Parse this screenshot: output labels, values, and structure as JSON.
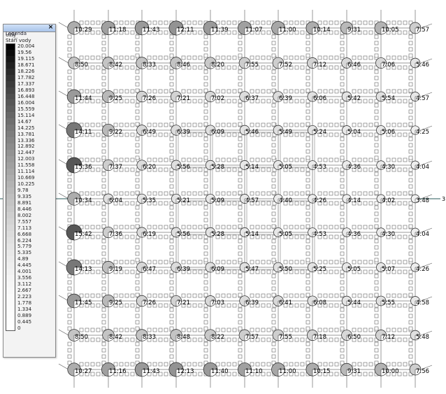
{
  "legend": {
    "title": "Legenda",
    "close_label": "×",
    "layer": "Uzly",
    "attribute": "Stáří vody",
    "scale": [
      {
        "value": "20.004",
        "color": "#000000"
      },
      {
        "value": "19.56",
        "color": "#0b0b0b"
      },
      {
        "value": "19.115",
        "color": "#161616"
      },
      {
        "value": "18.671",
        "color": "#202020"
      },
      {
        "value": "18.226",
        "color": "#2a2a2a"
      },
      {
        "value": "17.782",
        "color": "#333333"
      },
      {
        "value": "17.337",
        "color": "#3c3c3c"
      },
      {
        "value": "16.893",
        "color": "#454545"
      },
      {
        "value": "16.448",
        "color": "#4e4e4e"
      },
      {
        "value": "16.004",
        "color": "#575757"
      },
      {
        "value": "15.559",
        "color": "#5f5f5f"
      },
      {
        "value": "15.114",
        "color": "#676767"
      },
      {
        "value": "14.67",
        "color": "#6f6f6f"
      },
      {
        "value": "14.225",
        "color": "#777777"
      },
      {
        "value": "13.781",
        "color": "#7e7e7e"
      },
      {
        "value": "13.336",
        "color": "#858585"
      },
      {
        "value": "12.892",
        "color": "#8c8c8c"
      },
      {
        "value": "12.447",
        "color": "#939393"
      },
      {
        "value": "12.003",
        "color": "#9a9a9a"
      },
      {
        "value": "11.558",
        "color": "#a0a0a0"
      },
      {
        "value": "11.114",
        "color": "#a7a7a7"
      },
      {
        "value": "10.669",
        "color": "#adadad"
      },
      {
        "value": "10.225",
        "color": "#b3b3b3"
      },
      {
        "value": "9.78",
        "color": "#b9b9b9"
      },
      {
        "value": "9.335",
        "color": "#bfbfbf"
      },
      {
        "value": "8.891",
        "color": "#c4c4c4"
      },
      {
        "value": "8.446",
        "color": "#c9c9c9"
      },
      {
        "value": "8.002",
        "color": "#cecece"
      },
      {
        "value": "7.557",
        "color": "#d3d3d3"
      },
      {
        "value": "7.113",
        "color": "#d8d8d8"
      },
      {
        "value": "6.668",
        "color": "#dcdcdc"
      },
      {
        "value": "6.224",
        "color": "#e0e0e0"
      },
      {
        "value": "5.779",
        "color": "#e4e4e4"
      },
      {
        "value": "5.335",
        "color": "#e8e8e8"
      },
      {
        "value": "4.89",
        "color": "#ebebeb"
      },
      {
        "value": "4.445",
        "color": "#eeeeee"
      },
      {
        "value": "4.001",
        "color": "#f1f1f1"
      },
      {
        "value": "3.556",
        "color": "#f4f4f4"
      },
      {
        "value": "3.112",
        "color": "#f6f6f6"
      },
      {
        "value": "2.667",
        "color": "#f8f8f8"
      },
      {
        "value": "2.223",
        "color": "#fafafa"
      },
      {
        "value": "1.778",
        "color": "#fbfbfb"
      },
      {
        "value": "1.334",
        "color": "#fcfcfc"
      },
      {
        "value": "0.889",
        "color": "#fdfdfd"
      },
      {
        "value": "0.445",
        "color": "#fefefe"
      },
      {
        "value": "0",
        "color": "#ffffff"
      }
    ]
  },
  "grid": {
    "rows": [
      [
        "10:29",
        "11:18",
        "11:43",
        "12:11",
        "11:39",
        "11:07",
        "11:00",
        "10:14",
        "9:31",
        "10:05",
        "7:57"
      ],
      [
        "8:50",
        "8:42",
        "8:33",
        "8:46",
        "8:20",
        "7:55",
        "7:52",
        "7:12",
        "6:46",
        "7:06",
        "5:46"
      ],
      [
        "11:44",
        "9:25",
        "7:26",
        "7:21",
        "7:02",
        "6:37",
        "6:39",
        "6:06",
        "5:42",
        "5:54",
        "4:57"
      ],
      [
        "14:11",
        "9:22",
        "6:49",
        "6:39",
        "6:09",
        "5:46",
        "5:49",
        "5:24",
        "5:04",
        "5:06",
        "4:25"
      ],
      [
        "15:36",
        "7:37",
        "6:20",
        "5:56",
        "5:28",
        "5:14",
        "5:05",
        "4:53",
        "4:36",
        "4:30",
        "4:04"
      ],
      [
        "10:34",
        "6:04",
        "5:35",
        "5:21",
        "5:09",
        "4:57",
        "4:40",
        "4:26",
        "4:14",
        "4:02",
        "3:48"
      ],
      [
        "15:42",
        "7:36",
        "6:19",
        "5:56",
        "5:28",
        "5:14",
        "5:05",
        "4:53",
        "4:36",
        "4:30",
        "4:04"
      ],
      [
        "14:13",
        "9:19",
        "6:47",
        "6:39",
        "6:09",
        "5:47",
        "5:50",
        "5:25",
        "5:05",
        "5:07",
        "4:26"
      ],
      [
        "11:45",
        "9:25",
        "7:26",
        "7:21",
        "7:03",
        "6:39",
        "6:41",
        "6:08",
        "5:44",
        "5:55",
        "4:58"
      ],
      [
        "8:50",
        "8:42",
        "8:33",
        "8:48",
        "8:22",
        "7:57",
        "7:55",
        "7:18",
        "6:50",
        "7:12",
        "5:48"
      ],
      [
        "10:27",
        "11:16",
        "11:43",
        "12:13",
        "11:40",
        "11:10",
        "11:00",
        "10:15",
        "9:31",
        "10:00",
        "7:56"
      ]
    ],
    "source_label": "3"
  }
}
